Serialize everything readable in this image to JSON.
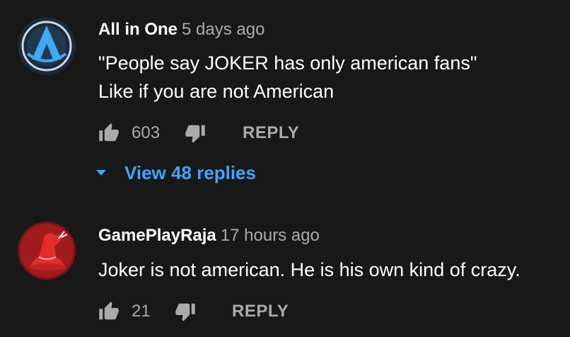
{
  "comments": [
    {
      "author": "All in One",
      "time": "5 days ago",
      "text_lines": [
        "\"People say JOKER has only american fans\"",
        "Like if you are not American"
      ],
      "likes": "603",
      "reply_label": "REPLY",
      "avatar_icon": "blue-a-logo-icon",
      "view_replies_label": "View 48 replies"
    },
    {
      "author": "GamePlayRaja",
      "time": "17 hours ago",
      "text_lines": [
        "Joker is not american. He is his own kind of crazy."
      ],
      "likes": "21",
      "reply_label": "REPLY",
      "avatar_icon": "red-wizard-hat-icon"
    }
  ],
  "colors": {
    "background": "#181818",
    "primary_text": "#ffffff",
    "secondary_text": "#aaaaaa",
    "link_blue": "#3ea6ff"
  }
}
